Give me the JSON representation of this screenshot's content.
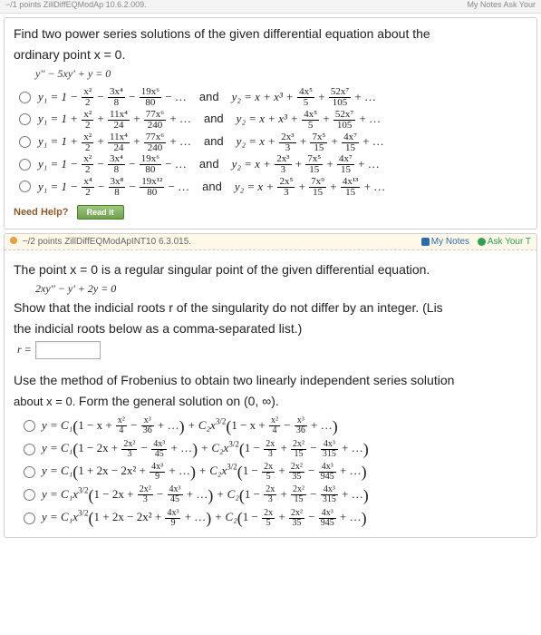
{
  "topstrip": {
    "left": "−/1 points  ZillDiffEQModAp 10.6.2.009.",
    "right_notes": "My Notes",
    "right_ask": "Ask Your"
  },
  "q1": {
    "prompt_line1": "Find two power series solutions of the given differential equation about the",
    "prompt_line2": "ordinary point x = 0.",
    "equation": "y'' − 5xy' + y = 0",
    "and": "and",
    "opts": [
      {
        "y1": {
          "lead": "y₁ = 1 −",
          "t1n": "x²",
          "t1d": "2",
          "s1": "−",
          "t2n": "3x⁴",
          "t2d": "8",
          "s2": "−",
          "t3n": "19x⁶",
          "t3d": "80",
          "tail": "− …"
        },
        "y2": {
          "lead": "y₂ = x + x³ +",
          "t1n": "4x⁵",
          "t1d": "5",
          "s1": "+",
          "t2n": "52x⁷",
          "t2d": "105",
          "tail": "+ …"
        }
      },
      {
        "y1": {
          "lead": "y₁ = 1 +",
          "t1n": "x²",
          "t1d": "2",
          "s1": "+",
          "t2n": "11x⁴",
          "t2d": "24",
          "s2": "+",
          "t3n": "77x⁶",
          "t3d": "240",
          "tail": "+ …"
        },
        "y2": {
          "lead": "y₂ = x + x³ +",
          "t1n": "4x⁵",
          "t1d": "5",
          "s1": "+",
          "t2n": "52x⁷",
          "t2d": "105",
          "tail": "+ …"
        }
      },
      {
        "y1": {
          "lead": "y₁ = 1 +",
          "t1n": "x²",
          "t1d": "2",
          "s1": "+",
          "t2n": "11x⁴",
          "t2d": "24",
          "s2": "+",
          "t3n": "77x⁶",
          "t3d": "240",
          "tail": "+ …"
        },
        "y2": {
          "lead": "y₂ = x +",
          "t1n": "2x³",
          "t1d": "3",
          "s1": "+",
          "t2n": "7x⁵",
          "t2d": "15",
          "s2": "+",
          "t3n": "4x⁷",
          "t3d": "15",
          "tail": "+ …"
        }
      },
      {
        "y1": {
          "lead": "y₁ = 1 −",
          "t1n": "x²",
          "t1d": "2",
          "s1": "−",
          "t2n": "3x⁴",
          "t2d": "8",
          "s2": "−",
          "t3n": "19x⁶",
          "t3d": "80",
          "tail": "− …"
        },
        "y2": {
          "lead": "y₂ = x +",
          "t1n": "2x³",
          "t1d": "3",
          "s1": "+",
          "t2n": "7x⁵",
          "t2d": "15",
          "s2": "+",
          "t3n": "4x⁷",
          "t3d": "15",
          "tail": "+ …"
        }
      },
      {
        "y1": {
          "lead": "y₁ = 1 −",
          "t1n": "x⁴",
          "t1d": "2",
          "s1": "−",
          "t2n": "3x⁸",
          "t2d": "8",
          "s2": "−",
          "t3n": "19x¹²",
          "t3d": "80",
          "tail": "− …"
        },
        "y2": {
          "lead": "y₂ = x +",
          "t1n": "2x⁵",
          "t1d": "3",
          "s1": "+",
          "t2n": "7x⁹",
          "t2d": "15",
          "s2": "+",
          "t3n": "4x¹³",
          "t3d": "15",
          "tail": "+ …"
        }
      }
    ],
    "help_label": "Need Help?",
    "readit": "Read it"
  },
  "q2": {
    "points": "−/2 points  ZillDiffEQModApINT10 6.3.015.",
    "notes": "My Notes",
    "ask": "Ask Your T",
    "l1": "The point x = 0 is a regular singular point of the given differential equation.",
    "eq": "2xy'' − y' + 2y = 0",
    "l2": "Show that the indicial roots r of the singularity do not differ by an integer. (Lis",
    "l3": "the indicial roots below as a comma-separated list.)",
    "rvar": "r =",
    "l4": "Use the method of Frobenius to obtain two linearly independent series solution",
    "l5_a": "about x = 0. ",
    "l5_b": "Form the general solution on (0, ∞).",
    "opts": [
      {
        "p1": {
          "lead": "y = C₁",
          "open": "(",
          "a": "1 − x +",
          "f1n": "x²",
          "f1d": "4",
          "s1": "−",
          "f2n": "x³",
          "f2d": "36",
          "tail": "+ …",
          "close": ")"
        },
        "p2": {
          "mid": " + C₂x",
          "exp": "3/2",
          "open": "(",
          "a": "1 − x +",
          "f1n": "x²",
          "f1d": "4",
          "s1": "−",
          "f2n": "x³",
          "f2d": "36",
          "tail": "+ …",
          "close": ")"
        }
      },
      {
        "p1": {
          "lead": "y = C₁",
          "open": "(",
          "a": "1 − 2x +",
          "f1n": "2x²",
          "f1d": "3",
          "s1": "−",
          "f2n": "4x³",
          "f2d": "45",
          "tail": "+ …",
          "close": ")"
        },
        "p2": {
          "mid": " + C₂x",
          "exp": "3/2",
          "open": "(",
          "a": "1 −",
          "f1n": "2x",
          "f1d": "3",
          "s1": "+",
          "f2n": "2x²",
          "f2d": "15",
          "s2": "−",
          "f3n": "4x³",
          "f3d": "315",
          "tail": "+ …",
          "close": ")"
        }
      },
      {
        "p1": {
          "lead": "y = C₁",
          "open": "(",
          "a": "1 + 2x − 2x² +",
          "f1n": "4x³",
          "f1d": "9",
          "tail": "+ …",
          "close": ")"
        },
        "p2": {
          "mid": " + C₂x",
          "exp": "3/2",
          "open": "(",
          "a": "1 −",
          "f1n": "2x",
          "f1d": "5",
          "s1": "+",
          "f2n": "2x²",
          "f2d": "35",
          "s2": "−",
          "f3n": "4x³",
          "f3d": "945",
          "tail": "+ …",
          "close": ")"
        }
      },
      {
        "p1": {
          "lead": "y = C₁x",
          "exp0": "3/2",
          "open": "(",
          "a": "1 − 2x +",
          "f1n": "2x²",
          "f1d": "3",
          "s1": "−",
          "f2n": "4x³",
          "f2d": "45",
          "tail": "+ …",
          "close": ")"
        },
        "p2": {
          "mid": " + C₂",
          "open": "(",
          "a": "1 −",
          "f1n": "2x",
          "f1d": "3",
          "s1": "+",
          "f2n": "2x²",
          "f2d": "15",
          "s2": "−",
          "f3n": "4x³",
          "f3d": "315",
          "tail": "+ …",
          "close": ")"
        }
      },
      {
        "p1": {
          "lead": "y = C₁x",
          "exp0": "3/2",
          "open": "(",
          "a": "1 + 2x − 2x² +",
          "f1n": "4x³",
          "f1d": "9",
          "tail": "+ …",
          "close": ")"
        },
        "p2": {
          "mid": " + C₂",
          "open": "(",
          "a": "1 −",
          "f1n": "2x",
          "f1d": "5",
          "s1": "+",
          "f2n": "2x²",
          "f2d": "35",
          "s2": "−",
          "f3n": "4x³",
          "f3d": "945",
          "tail": "+ …",
          "close": ")"
        }
      }
    ]
  }
}
